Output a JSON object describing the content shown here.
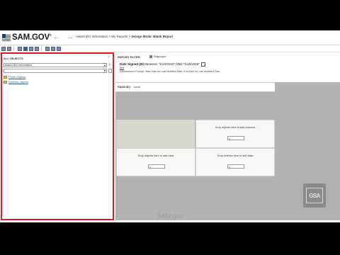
{
  "header": {
    "logo_text": "SAM",
    "logo_gov": ".GOV",
    "logo_mark": "®",
    "nav_back": "←",
    "nav_forward": "→",
    "breadcrumb": "Award IDV Information > My Reports >",
    "mode_label": "Design Mode: Blank Report"
  },
  "left_panel": {
    "title": "ALL OBJECTS",
    "close": "×",
    "selected_source": "Award IDV Information",
    "folders": [
      {
        "label": "Public Objects"
      },
      {
        "label": "Schema Objects"
      }
    ]
  },
  "report_filter": {
    "label": "REPORT FILTER:",
    "button": "Regroups",
    "condition_field": "Date Signed (ID)",
    "condition_op": "Between",
    "condition_value": "\"1/13/2018\" AND \"1/15/2018\"",
    "and_label": "And",
    "note": "(Unanswered Prompt: Start Date for Last Modified Date, End Date for Last Modified Date"
  },
  "page_by": {
    "label": "PAGE-BY:",
    "value": "none"
  },
  "drop_zones": {
    "columns": "Drop objects here to add columns",
    "rows": "Drop objects here to add rows",
    "data": "Drop metrics here to add data"
  },
  "badge": {
    "text": "GSA"
  },
  "caption": "SAM.gov",
  "colors": {
    "panel_border": "#e01b24",
    "link": "#2c5a91",
    "corner": "#d7d6cf",
    "grid_bg": "#b3b3b3"
  }
}
